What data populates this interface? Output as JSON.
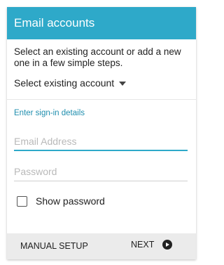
{
  "header": {
    "title": "Email accounts"
  },
  "intro": {
    "text": "Select an existing account or add a new one in a few simple steps."
  },
  "account_select": {
    "label": "Select existing account",
    "icon": "caret-down-icon"
  },
  "sign_in": {
    "section_label": "Enter sign-in details",
    "email_placeholder": "Email Address",
    "email_value": "",
    "password_placeholder": "Password",
    "password_value": "",
    "show_password_label": "Show password",
    "show_password_checked": false
  },
  "footer": {
    "manual_setup_label": "MANUAL SETUP",
    "next_label": "NEXT",
    "next_icon": "arrow-right-circle-icon"
  },
  "colors": {
    "accent": "#2ea9c9",
    "section_label": "#1f8eae",
    "footer_bg": "#ebebeb"
  }
}
